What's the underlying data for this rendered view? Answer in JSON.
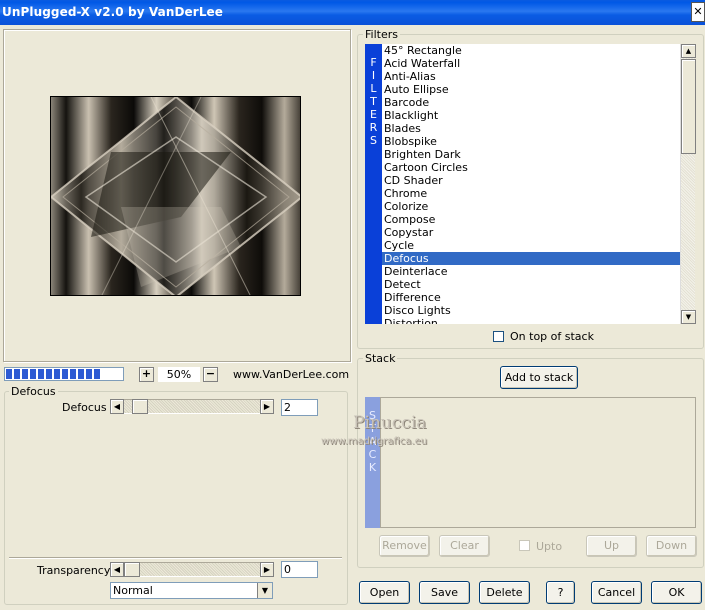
{
  "window": {
    "title": "UnPlugged-X v2.0 by VanDerLee",
    "close_icon": "close-icon"
  },
  "preview": {
    "zoom": "50%",
    "progress_segments": 12,
    "zoom_in_label": "+",
    "zoom_out_label": "−",
    "website": "www.VanDerLee.com"
  },
  "params": {
    "group_title": "Defocus",
    "defocus_label": "Defocus",
    "defocus_value": "2",
    "transparency_label": "Transparency",
    "transparency_value": "0",
    "blend_mode": "Normal"
  },
  "filters": {
    "group_title": "Filters",
    "vertical_label": [
      "F",
      "I",
      "L",
      "T",
      "E",
      "R",
      "S"
    ],
    "items": [
      "45° Rectangle",
      "Acid Waterfall",
      "Anti-Alias",
      "Auto Ellipse",
      "Barcode",
      "Blacklight",
      "Blades",
      "Blobspike",
      "Brighten Dark",
      "Cartoon Circles",
      "CD Shader",
      "Chrome",
      "Colorize",
      "Compose",
      "Copystar",
      "Cycle",
      "Defocus",
      "Deinterlace",
      "Detect",
      "Difference",
      "Disco Lights",
      "Distortion"
    ],
    "selected_index": 16,
    "on_top_label": "On top of stack"
  },
  "stack": {
    "group_title": "Stack",
    "add_label": "Add to stack",
    "vertical_label": [
      "S",
      "T",
      "A",
      "C",
      "K"
    ],
    "remove_label": "Remove",
    "clear_label": "Clear",
    "upto_label": "Upto",
    "up_label": "Up",
    "down_label": "Down"
  },
  "watermark": {
    "line1": "Pinuccia",
    "line2": "www.madrigrafica.eu"
  },
  "bottom_buttons": {
    "open": "Open",
    "save": "Save",
    "delete": "Delete",
    "help": "?",
    "cancel": "Cancel",
    "ok": "OK"
  },
  "colors": {
    "titlebar": "#0a5be0",
    "face": "#ece9d8",
    "selection": "#316ac5",
    "filters_strip": "#0a40d8",
    "stack_strip": "#8aa0de"
  }
}
